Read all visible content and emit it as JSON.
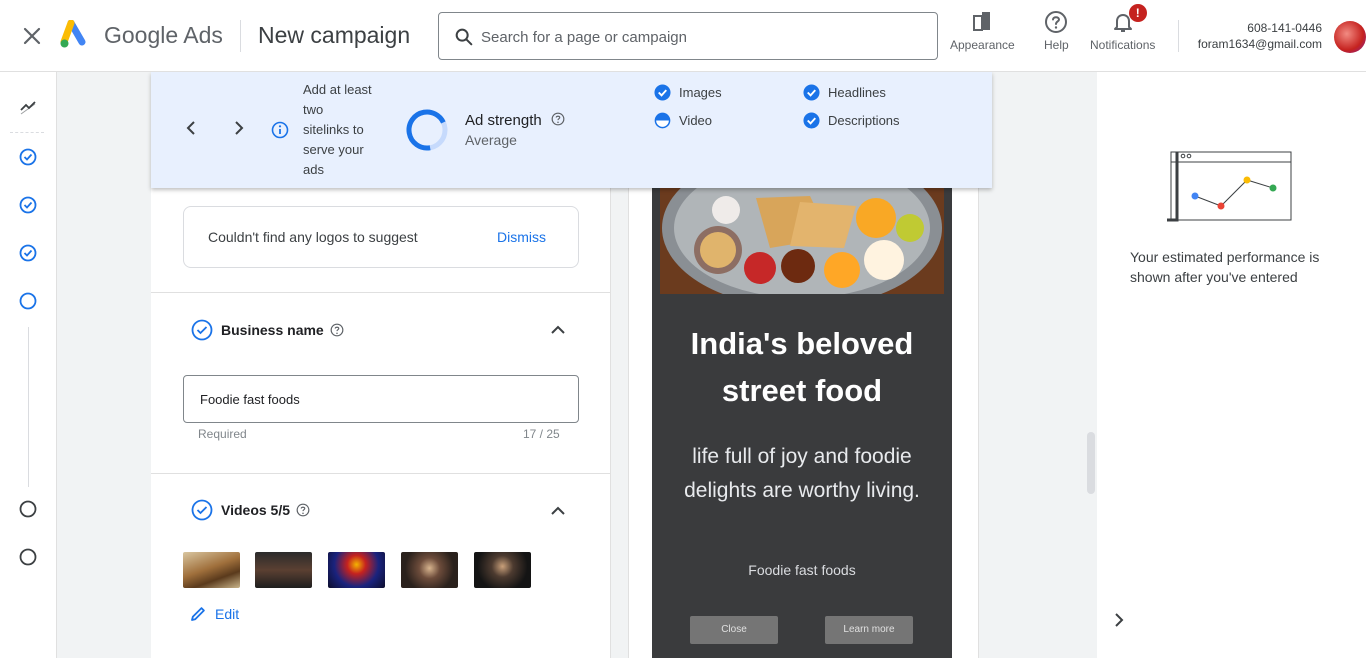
{
  "header": {
    "brand_google": "Google",
    "brand_ads": "Ads",
    "title": "New campaign",
    "search_placeholder": "Search for a page or campaign",
    "appearance_label": "Appearance",
    "help_label": "Help",
    "notifications_label": "Notifications",
    "notifications_badge": "!",
    "account_phone": "608-141-0446",
    "account_email": "foram1634@gmail.com"
  },
  "strength_bar": {
    "hint": "Add at least two sitelinks to serve your ads",
    "ad_strength_label": "Ad strength",
    "ad_strength_value": "Average",
    "checks": [
      {
        "label": "Images",
        "state": "complete"
      },
      {
        "label": "Video",
        "state": "partial"
      },
      {
        "label": "Headlines",
        "state": "complete"
      },
      {
        "label": "Descriptions",
        "state": "complete"
      }
    ]
  },
  "logo_card": {
    "message": "Couldn't find any logos to suggest",
    "dismiss_label": "Dismiss"
  },
  "business_name": {
    "label": "Business name",
    "value": "Foodie fast foods",
    "required_label": "Required",
    "counter": "17 / 25"
  },
  "videos": {
    "label": "Videos 5/5",
    "edit_label": "Edit"
  },
  "ad_preview": {
    "headline": "India's beloved street food",
    "description": "life full of joy and foodie delights are worthy living.",
    "business": "Foodie fast foods",
    "close_label": "Close",
    "learn_more_label": "Learn more"
  },
  "performance": {
    "text": "Your estimated performance is shown after you've entered"
  },
  "colors": {
    "accent": "#1a73e8",
    "strength_bg": "#e8f0fe",
    "badge": "#c5221f"
  }
}
